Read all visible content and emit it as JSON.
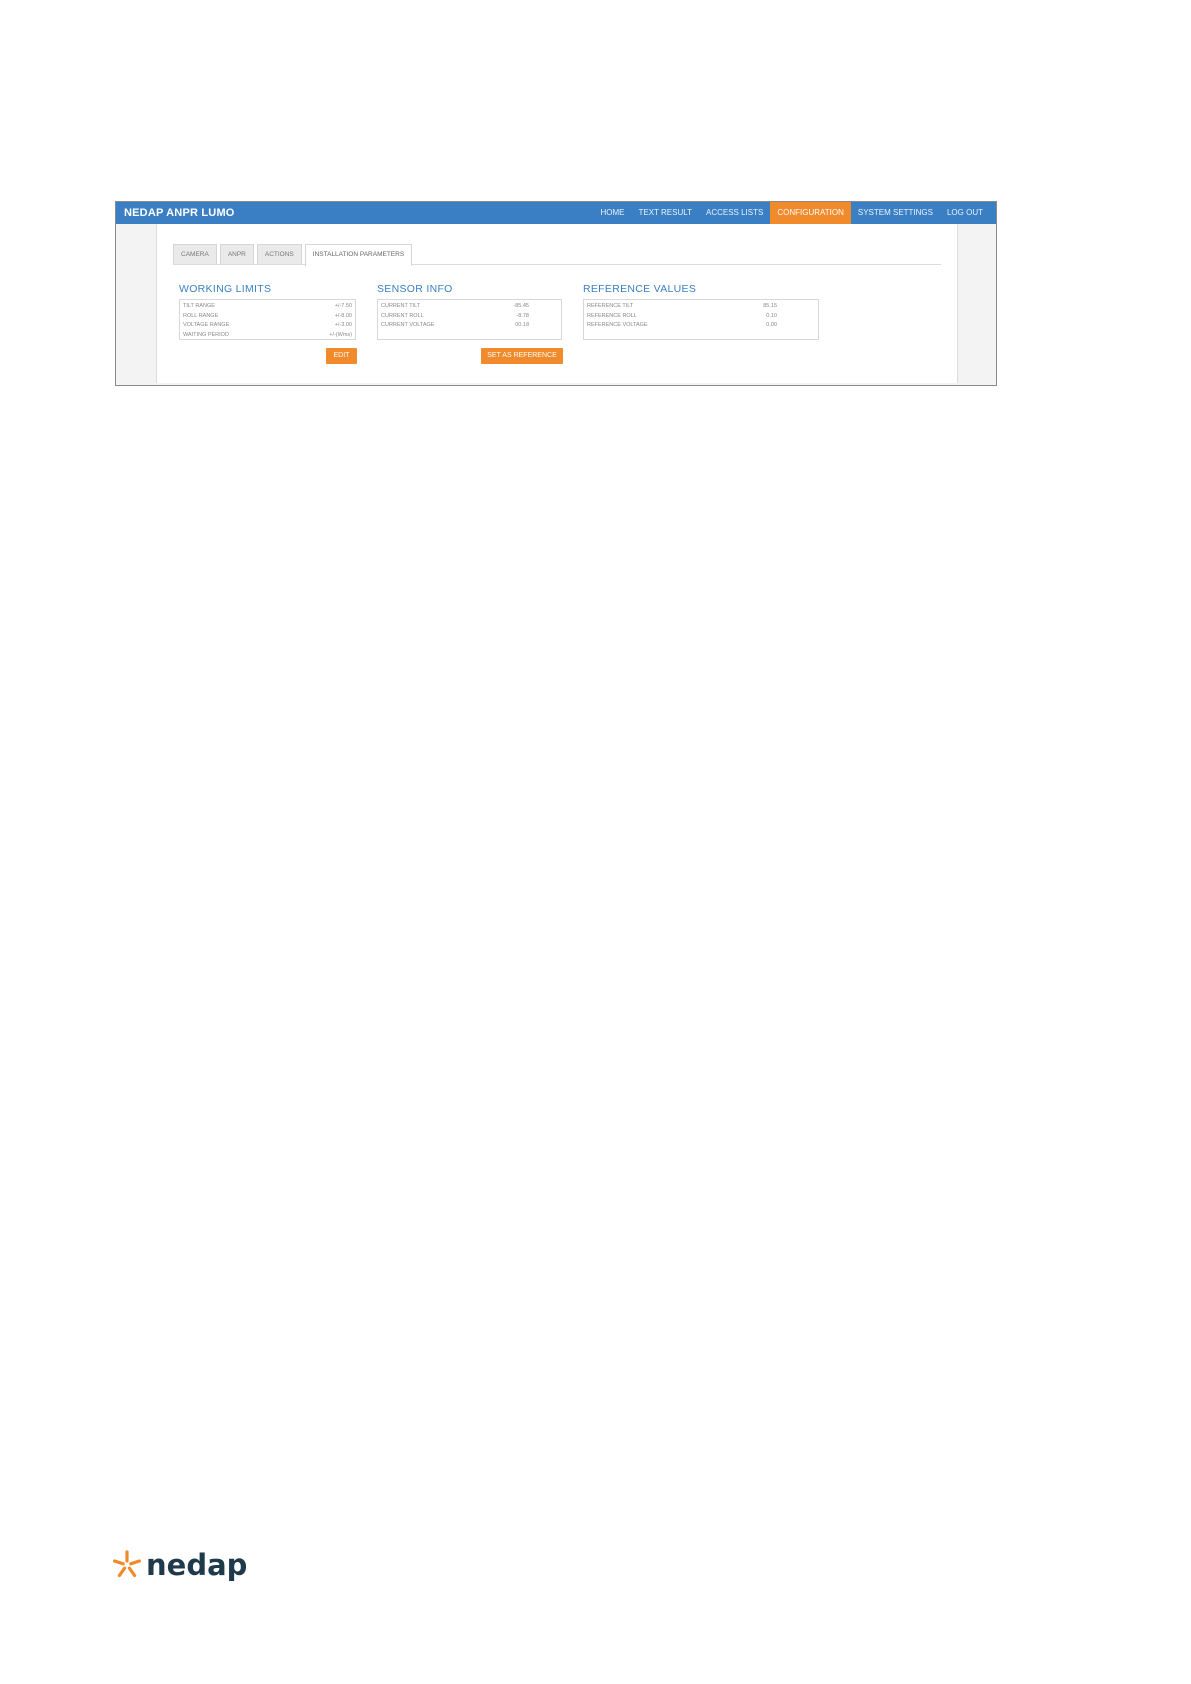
{
  "app": {
    "brand": "NEDAP ANPR LUMO",
    "nav": [
      "HOME",
      "TEXT RESULT",
      "ACCESS LISTS",
      "CONFIGURATION",
      "SYSTEM SETTINGS",
      "LOG OUT"
    ],
    "active_nav": "CONFIGURATION",
    "accent_color": "#f08a2b",
    "header_color": "#3a7fc4"
  },
  "tabs": [
    "CAMERA",
    "ANPR",
    "ACTIONS",
    "INSTALLATION PARAMETERS"
  ],
  "active_tab": "INSTALLATION PARAMETERS",
  "working_limits": {
    "title": "WORKING LIMITS",
    "rows": [
      {
        "label": "TILT RANGE",
        "value": "+/-7.50"
      },
      {
        "label": "ROLL RANGE",
        "value": "+/-8.00"
      },
      {
        "label": "VOLTAGE RANGE",
        "value": "+/-3.00"
      },
      {
        "label": "WAITING PERIOD",
        "value": "+/-(Wms)"
      }
    ],
    "button": "EDIT"
  },
  "sensor_info": {
    "title": "SENSOR INFO",
    "rows": [
      {
        "label": "CURRENT TILT",
        "value": "-85.45"
      },
      {
        "label": "CURRENT ROLL",
        "value": "-8.78"
      },
      {
        "label": "CURRENT VOLTAGE",
        "value": "00.18"
      }
    ],
    "button": "SET AS REFERENCE"
  },
  "reference_values": {
    "title": "REFERENCE VALUES",
    "rows": [
      {
        "label": "REFERENCE TILT",
        "value": "85.15"
      },
      {
        "label": "REFERENCE ROLL",
        "value": "0.10"
      },
      {
        "label": "REFERENCE VOLTAGE",
        "value": "0.00"
      }
    ]
  },
  "footer_logo": {
    "text": "nedap",
    "icon": "nedap-star-icon"
  }
}
